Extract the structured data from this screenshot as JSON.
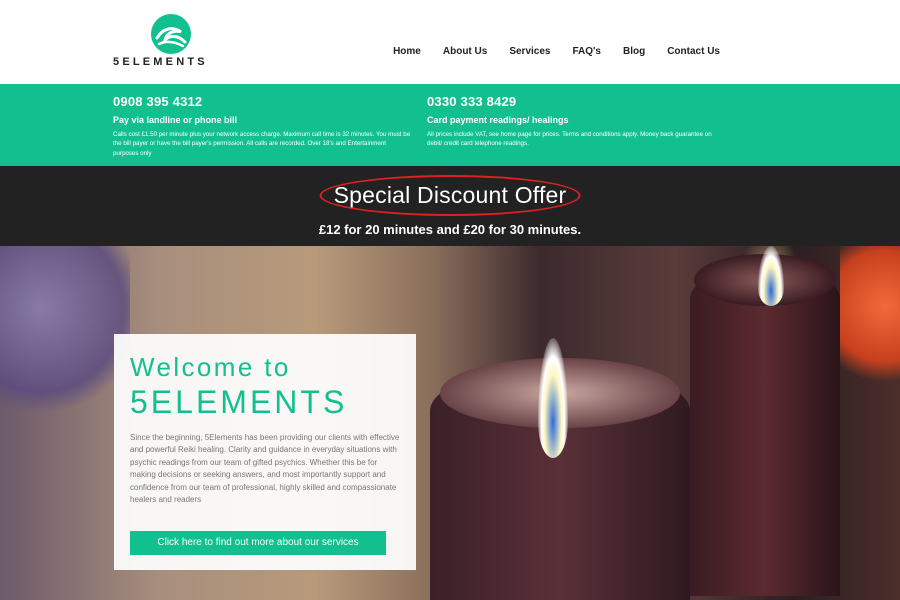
{
  "header": {
    "logo_text": "5ELEMENTS",
    "nav": [
      "Home",
      "About Us",
      "Services",
      "FAQ's",
      "Blog",
      "Contact Us"
    ]
  },
  "info": {
    "left": {
      "phone": "0908 395 4312",
      "subtitle": "Pay via landline or phone bill",
      "text": "Calls cost £1.50 per minute plus your network access charge. Maximum call time is 32 minutes. You must be the bill payer or have the bill payer's permission. All calls are recorded. Over 18's and Entertainment purposes only"
    },
    "right": {
      "phone": "0330 333 8429",
      "subtitle": "Card payment readings/ healings",
      "text": "All prices include VAT, see home page for prices. Terms and conditions apply. Money back guarantee on debit/ credit card telephone readings."
    }
  },
  "offer": {
    "title": "Special Discount Offer",
    "prices": "£12 for 20 minutes and £20 for 30 minutes."
  },
  "hero": {
    "welcome_line1": "Welcome to",
    "welcome_line2": "5ELEMENTS",
    "body": "Since the beginning, 5Elements has been providing our clients with effective and powerful Reiki healing. Clarity and guidance in everyday situations with psychic readings from our team of gifted psychics. Whether this be for making decisions or seeking answers, and most importantly support and confidence from our team of professional, highly skilled and compassionate healers and readers",
    "cta": "Click here to find out more about our services"
  },
  "colors": {
    "accent": "#12c08f",
    "dark_band": "#222222",
    "highlight_circle": "#e02020"
  }
}
